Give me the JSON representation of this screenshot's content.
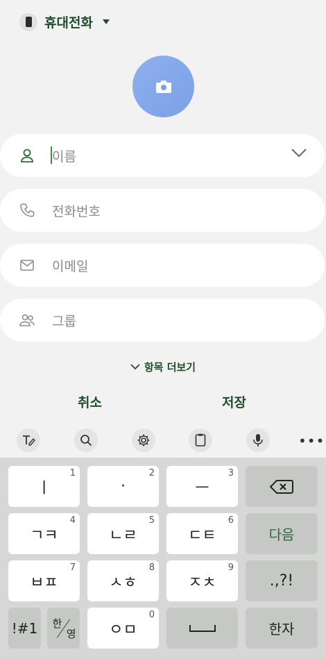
{
  "account": {
    "label": "휴대전화",
    "icon": "phone-icon"
  },
  "photo": {
    "icon": "camera-icon",
    "color": "#7ba0e6"
  },
  "fields": [
    {
      "icon": "person-icon",
      "placeholder": "이름"
    },
    {
      "icon": "call-icon",
      "placeholder": "전화번호"
    },
    {
      "icon": "mail-icon",
      "placeholder": "이메일"
    },
    {
      "icon": "group-icon",
      "placeholder": "그룹"
    }
  ],
  "more_fields": "항목 더보기",
  "actions": {
    "cancel": "취소",
    "save": "저장"
  },
  "toolbar": {
    "items": [
      "handwriting-icon",
      "search-icon",
      "settings-icon",
      "clipboard-icon",
      "mic-icon",
      "more-icon"
    ],
    "more_label": "•••"
  },
  "keyboard": {
    "row1": [
      {
        "label": "ㅣ",
        "num": "1"
      },
      {
        "label": "·",
        "num": "2"
      },
      {
        "label": "ㅡ",
        "num": "3"
      }
    ],
    "row2": [
      {
        "label": "ㄱㅋ",
        "num": "4"
      },
      {
        "label": "ㄴㄹ",
        "num": "5"
      },
      {
        "label": "ㄷㅌ",
        "num": "6"
      }
    ],
    "row3": [
      {
        "label": "ㅂㅍ",
        "num": "7"
      },
      {
        "label": "ㅅㅎ",
        "num": "8"
      },
      {
        "label": "ㅈㅊ",
        "num": "9"
      }
    ],
    "row4_center": {
      "label": "ㅇㅁ",
      "num": "0"
    },
    "next": "다음",
    "punct": ".,?!",
    "sym": "!#1",
    "han": "한",
    "young": "영",
    "hanja": "한자",
    "accent": "#2e6b3a"
  }
}
